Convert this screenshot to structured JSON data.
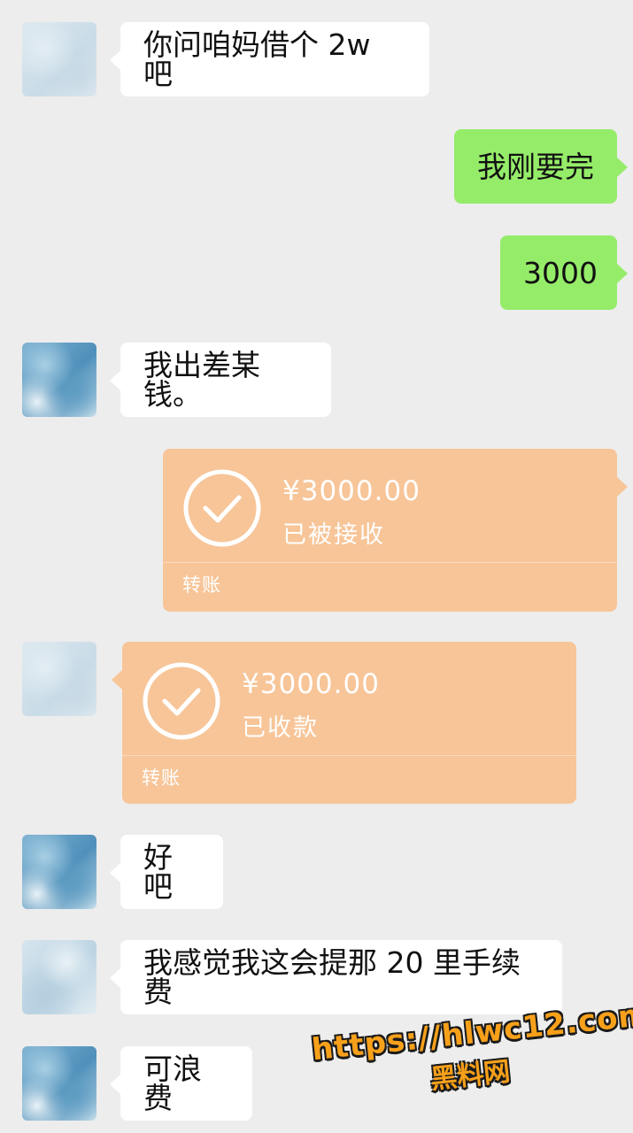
{
  "messages": [
    {
      "side": "in",
      "text": "你问咱妈借个 2w 吧"
    },
    {
      "side": "out",
      "text": "我刚要完"
    },
    {
      "side": "out",
      "text": "3000"
    },
    {
      "side": "in",
      "text": "我出差某钱。"
    },
    {
      "side": "out",
      "type": "transfer",
      "amount": "¥3000.00",
      "status": "已被接收",
      "label": "转账"
    },
    {
      "side": "in",
      "type": "transfer",
      "amount": "¥3000.00",
      "status": "已收款",
      "label": "转账"
    },
    {
      "side": "in",
      "text": "好吧"
    },
    {
      "side": "in",
      "text": "我感觉我这会提那 20 里手续费"
    },
    {
      "side": "in",
      "text": "可浪费"
    }
  ],
  "watermark": {
    "url": "https://hlwc12.com",
    "name": "黑料网"
  },
  "colors": {
    "background": "#ededed",
    "incoming": "#ffffff",
    "outgoing": "#95ec69",
    "transfer": "#f7c598"
  }
}
